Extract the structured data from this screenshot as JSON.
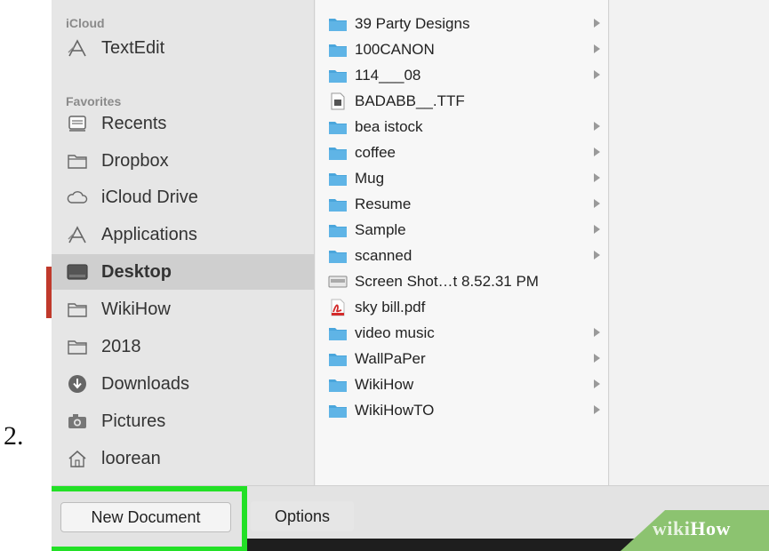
{
  "step_label": "2.",
  "sidebar": {
    "sections": [
      {
        "heading": "iCloud",
        "items": [
          {
            "label": "TextEdit",
            "icon": "textedit-icon"
          }
        ]
      },
      {
        "heading": "Favorites",
        "items": [
          {
            "label": "Recents",
            "icon": "recents-icon"
          },
          {
            "label": "Dropbox",
            "icon": "folder-icon"
          },
          {
            "label": "iCloud Drive",
            "icon": "cloud-icon"
          },
          {
            "label": "Applications",
            "icon": "applications-icon"
          },
          {
            "label": "Desktop",
            "icon": "desktop-icon",
            "selected": true
          },
          {
            "label": "WikiHow",
            "icon": "folder-icon"
          },
          {
            "label": "2018",
            "icon": "folder-icon"
          },
          {
            "label": "Downloads",
            "icon": "downloads-icon"
          },
          {
            "label": "Pictures",
            "icon": "camera-icon"
          },
          {
            "label": "loorean",
            "icon": "home-icon"
          }
        ]
      }
    ]
  },
  "files": [
    {
      "name": "39 Party Designs",
      "type": "folder"
    },
    {
      "name": "100CANON",
      "type": "folder"
    },
    {
      "name": "114___08",
      "type": "folder"
    },
    {
      "name": "BADABB__.TTF",
      "type": "font"
    },
    {
      "name": "bea istock",
      "type": "folder"
    },
    {
      "name": "coffee",
      "type": "folder"
    },
    {
      "name": "Mug",
      "type": "folder"
    },
    {
      "name": "Resume",
      "type": "folder"
    },
    {
      "name": "Sample",
      "type": "folder"
    },
    {
      "name": "scanned",
      "type": "folder"
    },
    {
      "name": "Screen Shot…t 8.52.31 PM",
      "type": "image"
    },
    {
      "name": "sky bill.pdf",
      "type": "pdf"
    },
    {
      "name": "video music",
      "type": "folder"
    },
    {
      "name": "WallPaPer",
      "type": "folder"
    },
    {
      "name": "WikiHow",
      "type": "folder"
    },
    {
      "name": "WikiHowTO",
      "type": "folder"
    }
  ],
  "bottom_bar": {
    "new_document_label": "New Document",
    "options_label": "Options"
  },
  "watermark": {
    "part1": "wiki",
    "part2": "How"
  },
  "colors": {
    "folder": "#4aa6dc",
    "highlight": "#22e026",
    "selected_row": "#cfcfcf",
    "watermark_bg": "#8cc370"
  }
}
